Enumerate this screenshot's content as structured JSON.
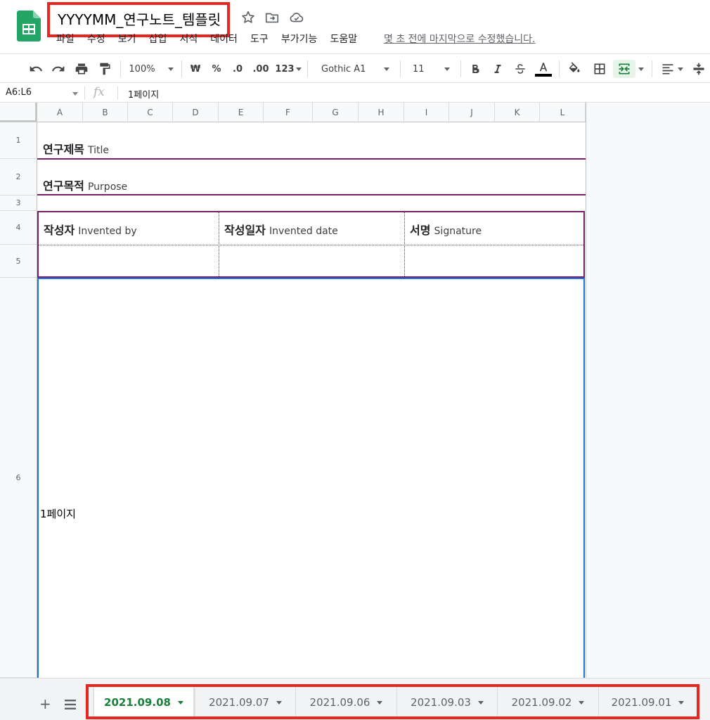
{
  "doc": {
    "title": "YYYYMM_연구노트_템플릿",
    "last_edit": "몇 초 전에 마지막으로 수정했습니다."
  },
  "menu": [
    "파일",
    "수정",
    "보기",
    "삽입",
    "서식",
    "데이터",
    "도구",
    "부가기능",
    "도움말"
  ],
  "toolbar": {
    "zoom": "100%",
    "currency": "₩",
    "percent": "%",
    "dec_decrease": ".0",
    "dec_increase": ".00",
    "format_more": "123",
    "font": "Gothic A1",
    "font_size": "11"
  },
  "formula_bar": {
    "range": "A6:L6",
    "fx": "fx",
    "value": "1페이지"
  },
  "columns": [
    "A",
    "B",
    "C",
    "D",
    "E",
    "F",
    "G",
    "H",
    "I",
    "J",
    "K",
    "L"
  ],
  "rows": [
    "1",
    "2",
    "3",
    "4",
    "5",
    "6"
  ],
  "cells": {
    "title_ko": "연구제목",
    "title_en": "Title",
    "purpose_ko": "연구목적",
    "purpose_en": "Purpose",
    "author_ko": "작성자",
    "author_en": "Invented by",
    "date_ko": "작성일자",
    "date_en": "Invented date",
    "signature_ko": "서명",
    "signature_en": "Signature",
    "page": "1페이지"
  },
  "sheets": {
    "add": "+",
    "tabs": [
      "2021.09.08",
      "2021.09.07",
      "2021.09.06",
      "2021.09.03",
      "2021.09.02",
      "2021.09.01"
    ],
    "active_index": 0
  },
  "colors": {
    "brand_green": "#188038",
    "highlight_red": "#e8261f",
    "border_purple": "#7b1f66",
    "selection_blue": "#1a73e8"
  }
}
